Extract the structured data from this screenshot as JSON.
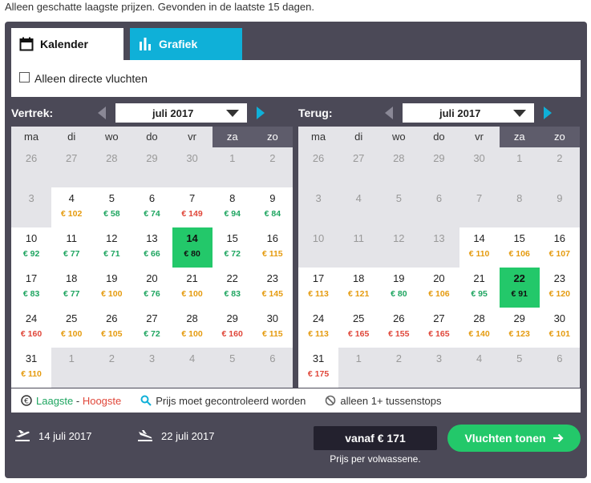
{
  "note": "Alleen geschatte laagste prijzen. Gevonden in de laatste 15 dagen.",
  "tabs": {
    "calendar": "Kalender",
    "graph": "Grafiek"
  },
  "direct_label": "Alleen directe vluchten",
  "outbound": {
    "label": "Vertrek:",
    "month": "juli 2017"
  },
  "return": {
    "label": "Terug:",
    "month": "juli 2017"
  },
  "weekdays": [
    "ma",
    "di",
    "wo",
    "do",
    "vr",
    "za",
    "zo"
  ],
  "outbound_days": [
    {
      "d": "26",
      "s": "off"
    },
    {
      "d": "27",
      "s": "off"
    },
    {
      "d": "28",
      "s": "off"
    },
    {
      "d": "29",
      "s": "off"
    },
    {
      "d": "30",
      "s": "off"
    },
    {
      "d": "1",
      "s": "off"
    },
    {
      "d": "2",
      "s": "off"
    },
    {
      "d": "3",
      "s": "off"
    },
    {
      "d": "4",
      "p": "€ 102",
      "c": "o",
      "s": "on"
    },
    {
      "d": "5",
      "p": "€ 58",
      "c": "g",
      "s": "on"
    },
    {
      "d": "6",
      "p": "€ 74",
      "c": "g",
      "s": "on"
    },
    {
      "d": "7",
      "p": "€ 149",
      "c": "r",
      "s": "on"
    },
    {
      "d": "8",
      "p": "€ 94",
      "c": "g",
      "s": "on"
    },
    {
      "d": "9",
      "p": "€ 84",
      "c": "g",
      "s": "on"
    },
    {
      "d": "10",
      "p": "€ 92",
      "c": "g",
      "s": "on"
    },
    {
      "d": "11",
      "p": "€ 77",
      "c": "g",
      "s": "on"
    },
    {
      "d": "12",
      "p": "€ 71",
      "c": "g",
      "s": "on"
    },
    {
      "d": "13",
      "p": "€ 66",
      "c": "g",
      "s": "on"
    },
    {
      "d": "14",
      "p": "€ 80",
      "c": "g",
      "s": "sel"
    },
    {
      "d": "15",
      "p": "€ 72",
      "c": "g",
      "s": "on"
    },
    {
      "d": "16",
      "p": "€ 115",
      "c": "o",
      "s": "on"
    },
    {
      "d": "17",
      "p": "€ 83",
      "c": "g",
      "s": "on"
    },
    {
      "d": "18",
      "p": "€ 77",
      "c": "g",
      "s": "on"
    },
    {
      "d": "19",
      "p": "€ 100",
      "c": "o",
      "s": "on"
    },
    {
      "d": "20",
      "p": "€ 76",
      "c": "g",
      "s": "on"
    },
    {
      "d": "21",
      "p": "€ 100",
      "c": "o",
      "s": "on"
    },
    {
      "d": "22",
      "p": "€ 83",
      "c": "g",
      "s": "on"
    },
    {
      "d": "23",
      "p": "€ 145",
      "c": "o",
      "s": "on"
    },
    {
      "d": "24",
      "p": "€ 160",
      "c": "r",
      "s": "on"
    },
    {
      "d": "25",
      "p": "€ 100",
      "c": "o",
      "s": "on"
    },
    {
      "d": "26",
      "p": "€ 105",
      "c": "o",
      "s": "on"
    },
    {
      "d": "27",
      "p": "€ 72",
      "c": "g",
      "s": "on"
    },
    {
      "d": "28",
      "p": "€ 100",
      "c": "o",
      "s": "on"
    },
    {
      "d": "29",
      "p": "€ 160",
      "c": "r",
      "s": "on"
    },
    {
      "d": "30",
      "p": "€ 115",
      "c": "o",
      "s": "on"
    },
    {
      "d": "31",
      "p": "€ 110",
      "c": "o",
      "s": "on"
    },
    {
      "d": "1",
      "s": "off"
    },
    {
      "d": "2",
      "s": "off"
    },
    {
      "d": "3",
      "s": "off"
    },
    {
      "d": "4",
      "s": "off"
    },
    {
      "d": "5",
      "s": "off"
    },
    {
      "d": "6",
      "s": "off"
    }
  ],
  "return_days": [
    {
      "d": "26",
      "s": "off"
    },
    {
      "d": "27",
      "s": "off"
    },
    {
      "d": "28",
      "s": "off"
    },
    {
      "d": "29",
      "s": "off"
    },
    {
      "d": "30",
      "s": "off"
    },
    {
      "d": "1",
      "s": "off"
    },
    {
      "d": "2",
      "s": "off"
    },
    {
      "d": "3",
      "s": "off"
    },
    {
      "d": "4",
      "s": "off"
    },
    {
      "d": "5",
      "s": "off"
    },
    {
      "d": "6",
      "s": "off"
    },
    {
      "d": "7",
      "s": "off"
    },
    {
      "d": "8",
      "s": "off"
    },
    {
      "d": "9",
      "s": "off"
    },
    {
      "d": "10",
      "s": "off"
    },
    {
      "d": "11",
      "s": "off"
    },
    {
      "d": "12",
      "s": "off"
    },
    {
      "d": "13",
      "s": "off"
    },
    {
      "d": "14",
      "p": "€ 110",
      "c": "o",
      "s": "on"
    },
    {
      "d": "15",
      "p": "€ 106",
      "c": "o",
      "s": "on"
    },
    {
      "d": "16",
      "p": "€ 107",
      "c": "o",
      "s": "on"
    },
    {
      "d": "17",
      "p": "€ 113",
      "c": "o",
      "s": "on"
    },
    {
      "d": "18",
      "p": "€ 121",
      "c": "o",
      "s": "on"
    },
    {
      "d": "19",
      "p": "€ 80",
      "c": "g",
      "s": "on"
    },
    {
      "d": "20",
      "p": "€ 106",
      "c": "o",
      "s": "on"
    },
    {
      "d": "21",
      "p": "€ 95",
      "c": "g",
      "s": "on"
    },
    {
      "d": "22",
      "p": "€ 91",
      "c": "g",
      "s": "sel"
    },
    {
      "d": "23",
      "p": "€ 120",
      "c": "o",
      "s": "on"
    },
    {
      "d": "24",
      "p": "€ 113",
      "c": "o",
      "s": "on"
    },
    {
      "d": "25",
      "p": "€ 165",
      "c": "r",
      "s": "on"
    },
    {
      "d": "26",
      "p": "€ 155",
      "c": "r",
      "s": "on"
    },
    {
      "d": "27",
      "p": "€ 165",
      "c": "r",
      "s": "on"
    },
    {
      "d": "28",
      "p": "€ 140",
      "c": "o",
      "s": "on"
    },
    {
      "d": "29",
      "p": "€ 123",
      "c": "o",
      "s": "on"
    },
    {
      "d": "30",
      "p": "€ 101",
      "c": "o",
      "s": "on"
    },
    {
      "d": "31",
      "p": "€ 175",
      "c": "r",
      "s": "on"
    },
    {
      "d": "1",
      "s": "off"
    },
    {
      "d": "2",
      "s": "off"
    },
    {
      "d": "3",
      "s": "off"
    },
    {
      "d": "4",
      "s": "off"
    },
    {
      "d": "5",
      "s": "off"
    },
    {
      "d": "6",
      "s": "off"
    }
  ],
  "legend": {
    "lowest": "Laagste",
    "dash": " - ",
    "highest": "Hoogste",
    "check": "Prijs moet gecontroleerd worden",
    "stops": "alleen 1+ tussenstops"
  },
  "footer": {
    "depart_date": "14 juli 2017",
    "return_date": "22 juli 2017",
    "price": "vanaf € 171",
    "per_person": "Prijs per volwassene.",
    "button": "Vluchten tonen"
  },
  "colors": {
    "panel": "#4b4957",
    "accent_blue": "#0fb0d8",
    "accent_green": "#23c86a",
    "low": "#1ea560",
    "mid": "#e59b0f",
    "high": "#e0473a"
  }
}
